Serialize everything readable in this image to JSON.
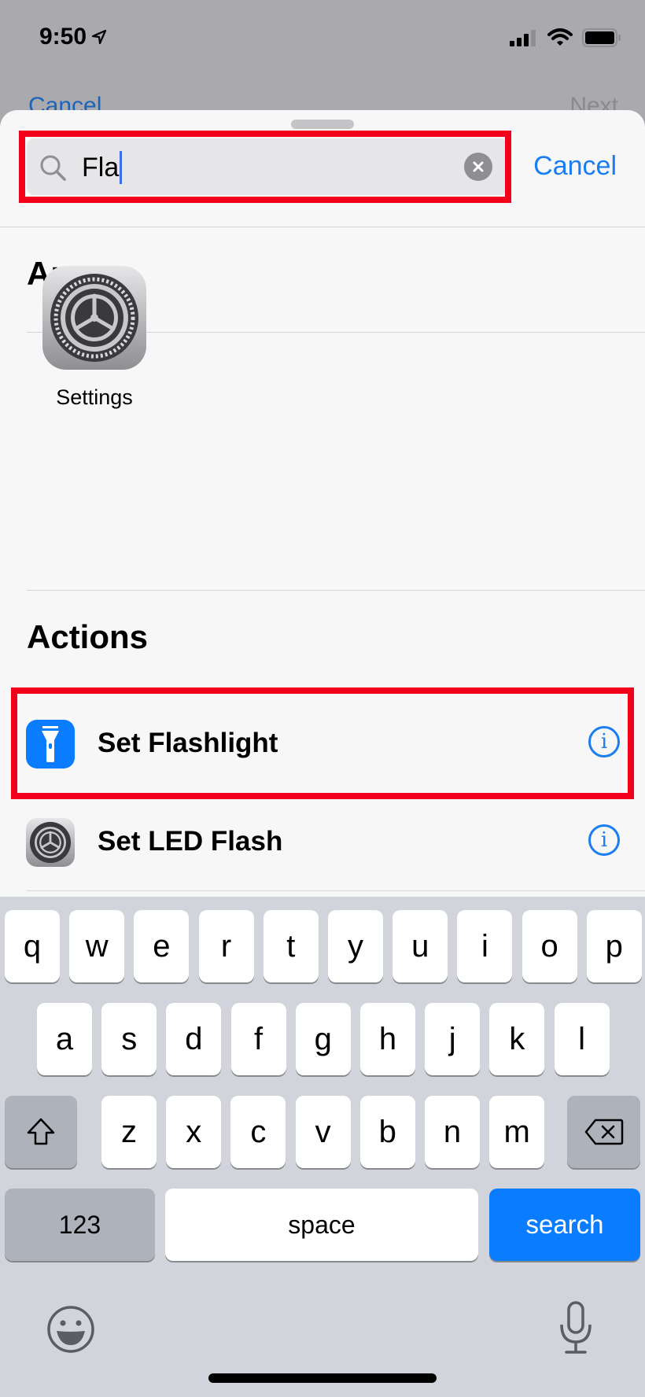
{
  "status_bar": {
    "time": "9:50",
    "location_icon": "location-arrow-icon",
    "signal_icon": "cellular-signal-icon",
    "wifi_icon": "wifi-icon",
    "battery_icon": "battery-icon"
  },
  "background_nav": {
    "left_label": "Cancel",
    "right_label": "Next"
  },
  "search": {
    "value": "Fla",
    "placeholder": "",
    "cancel_label": "Cancel",
    "search_icon": "magnifier-icon",
    "clear_icon": "clear-x-icon"
  },
  "apps_section": {
    "title": "Apps",
    "items": [
      {
        "label": "Settings",
        "icon": "settings-gear-icon"
      }
    ]
  },
  "actions_section": {
    "title": "Actions",
    "items": [
      {
        "label": "Set Flashlight",
        "icon": "flashlight-icon",
        "icon_color": "#0a7cff",
        "info_icon": "info-icon",
        "highlighted": true
      },
      {
        "label": "Set LED Flash",
        "icon": "settings-gear-icon",
        "info_icon": "info-icon",
        "highlighted": false
      }
    ]
  },
  "highlight_color": "#f2001c",
  "accent_color": "#1a7ef2",
  "keyboard": {
    "row1": [
      "q",
      "w",
      "e",
      "r",
      "t",
      "y",
      "u",
      "i",
      "o",
      "p"
    ],
    "row2": [
      "a",
      "s",
      "d",
      "f",
      "g",
      "h",
      "j",
      "k",
      "l"
    ],
    "row3": [
      "z",
      "x",
      "c",
      "v",
      "b",
      "n",
      "m"
    ],
    "shift_icon": "shift-arrow-icon",
    "delete_icon": "backspace-icon",
    "numbers_label": "123",
    "space_label": "space",
    "return_label": "search",
    "emoji_icon": "emoji-icon",
    "mic_icon": "microphone-icon"
  }
}
